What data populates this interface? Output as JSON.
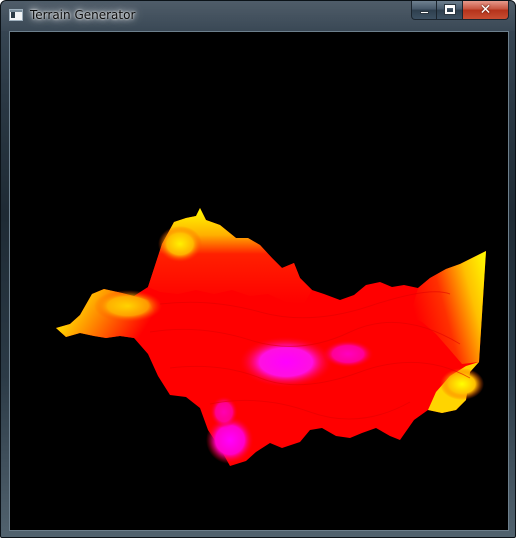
{
  "window": {
    "title": "Terrain Generator",
    "controls": {
      "minimize_icon": "minimize-icon",
      "maximize_icon": "maximize-icon",
      "close_icon": "close-icon",
      "close_glyph": "✕"
    }
  },
  "viewport": {
    "background": "#000000",
    "render": "3d-terrain-heightmap",
    "colors": {
      "high": "#ffff00",
      "mid": "#ff0000",
      "low": "#ff00ff"
    }
  }
}
